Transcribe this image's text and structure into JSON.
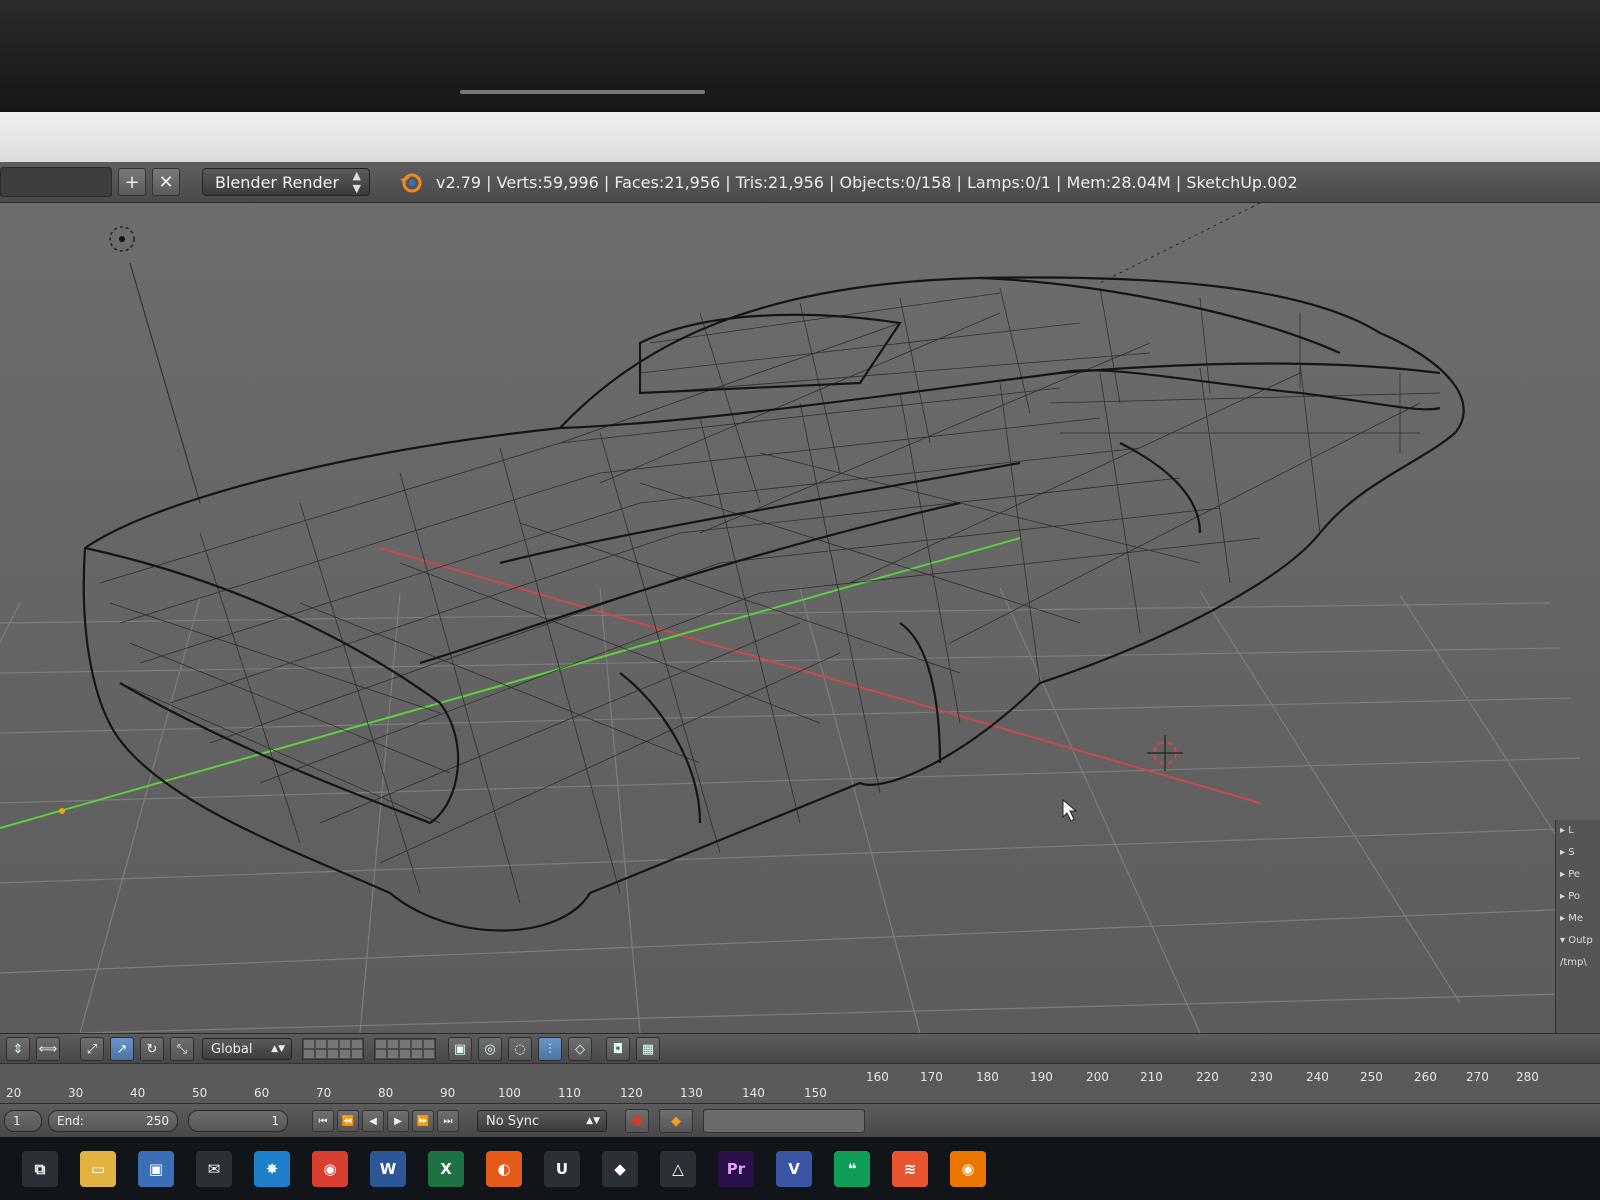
{
  "header": {
    "render_engine": "Blender Render",
    "stats": "v2.79 | Verts:59,996 | Faces:21,956 | Tris:21,956 | Objects:0/158 | Lamps:0/1 | Mem:28.04M | SketchUp.002",
    "add_label": "+",
    "close_label": "✕"
  },
  "viewport_header": {
    "orientation": "Global"
  },
  "timeline": {
    "ruler_top": [
      "160",
      "170",
      "180",
      "190",
      "200",
      "210",
      "220",
      "230",
      "240",
      "250",
      "260",
      "270",
      "280"
    ],
    "ruler_bottom": [
      "20",
      "30",
      "40",
      "50",
      "60",
      "70",
      "80",
      "90",
      "100",
      "110",
      "120",
      "130",
      "140",
      "150"
    ],
    "start_value": "1",
    "end_label": "End:",
    "end_value": "250",
    "current_frame": "1",
    "sync": "No Sync"
  },
  "properties_panel": {
    "items": [
      "▸ L",
      "▸ S",
      "▸ Pe",
      "▸ Po",
      "▸ Me",
      "▾ Outp",
      "/tmp\\"
    ]
  },
  "taskbar": {
    "icons": [
      {
        "name": "task-view-icon",
        "glyph": "⧉",
        "color": "#2b2f36"
      },
      {
        "name": "file-explorer-icon",
        "glyph": "▭",
        "color": "#e3b341"
      },
      {
        "name": "store-icon",
        "glyph": "▣",
        "color": "#3a6fb5"
      },
      {
        "name": "mail-icon",
        "glyph": "✉",
        "color": "#2b2f36"
      },
      {
        "name": "network-app-icon",
        "glyph": "✸",
        "color": "#1d7fc7"
      },
      {
        "name": "chrome-icon",
        "glyph": "◉",
        "color": "#d93e30"
      },
      {
        "name": "word-icon",
        "glyph": "W",
        "color": "#2b5797"
      },
      {
        "name": "excel-icon",
        "glyph": "X",
        "color": "#1e7145"
      },
      {
        "name": "origin-icon",
        "glyph": "◐",
        "color": "#e35a1b"
      },
      {
        "name": "unreal-icon",
        "glyph": "U",
        "color": "#2b2f36"
      },
      {
        "name": "unity-icon",
        "glyph": "◆",
        "color": "#2b2f36"
      },
      {
        "name": "sketchup-icon",
        "glyph": "△",
        "color": "#2b2f36"
      },
      {
        "name": "premiere-icon",
        "glyph": "Pr",
        "color": "#2a0f4a"
      },
      {
        "name": "visio-icon",
        "glyph": "V",
        "color": "#3955a3"
      },
      {
        "name": "hangouts-icon",
        "glyph": "❝",
        "color": "#0f9d58"
      },
      {
        "name": "anydesk-icon",
        "glyph": "≋",
        "color": "#e8542f"
      },
      {
        "name": "blender-icon",
        "glyph": "◉",
        "color": "#ea7600"
      }
    ]
  },
  "colors": {
    "x_axis": "#c84a4a",
    "y_axis": "#5fcf3c",
    "wireframe": "#151515",
    "viewport_bg": "#656565"
  }
}
